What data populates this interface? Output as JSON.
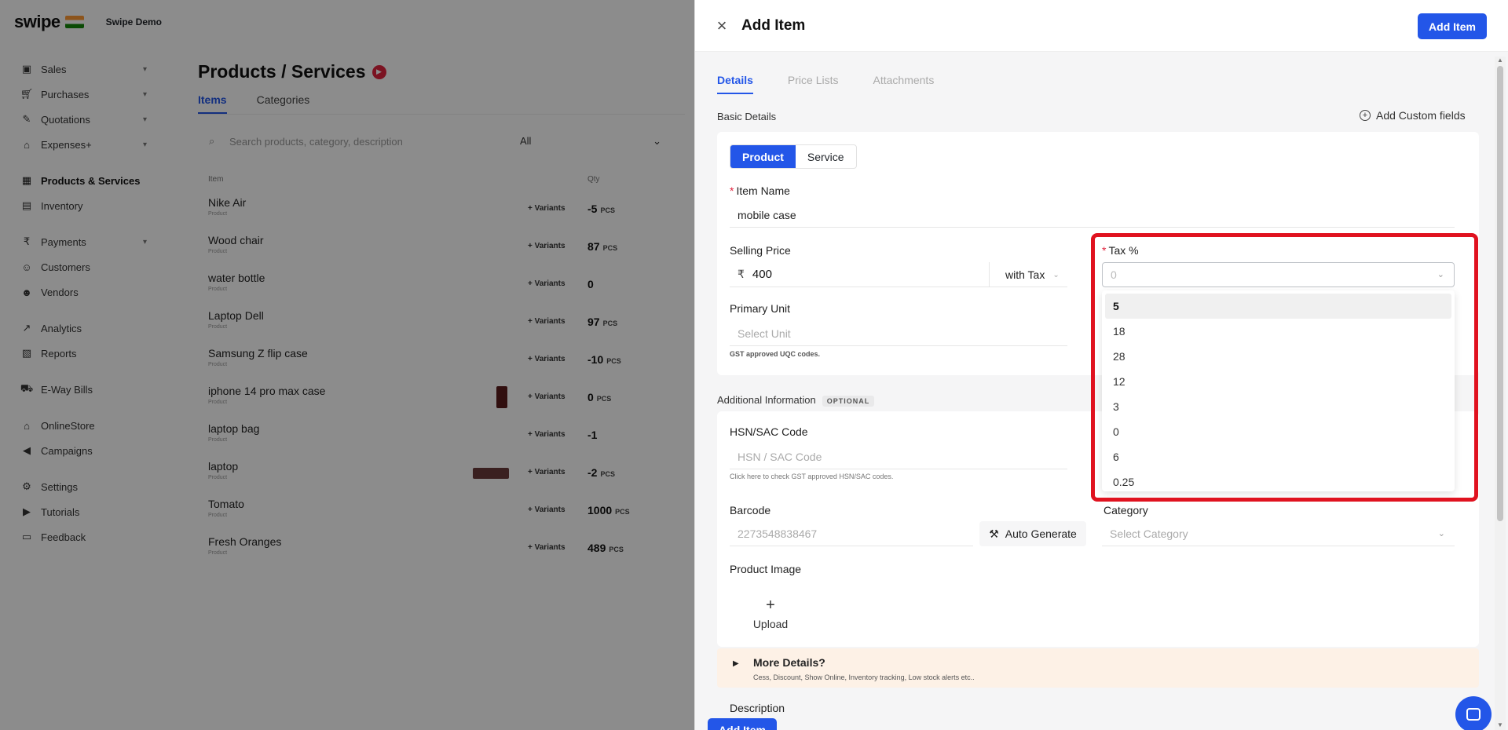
{
  "app": {
    "logo": "swipe",
    "company_name": "Swipe Demo"
  },
  "sidebar": {
    "items": [
      {
        "label": "Sales",
        "icon": "sales-icon"
      },
      {
        "label": "Purchases",
        "icon": "cart-icon"
      },
      {
        "label": "Quotations",
        "icon": "pen-icon"
      },
      {
        "label": "Expenses+",
        "icon": "tag-icon"
      },
      {
        "label": "Products & Services",
        "icon": "grid-icon"
      },
      {
        "label": "Inventory",
        "icon": "inventory-icon"
      },
      {
        "label": "Payments",
        "icon": "rupee-icon"
      },
      {
        "label": "Customers",
        "icon": "user-icon"
      },
      {
        "label": "Vendors",
        "icon": "users-icon"
      },
      {
        "label": "Analytics",
        "icon": "chart-icon"
      },
      {
        "label": "Reports",
        "icon": "report-icon"
      },
      {
        "label": "E-Way Bills",
        "icon": "truck-icon"
      },
      {
        "label": "OnlineStore",
        "icon": "store-icon"
      },
      {
        "label": "Campaigns",
        "icon": "megaphone-icon"
      },
      {
        "label": "Settings",
        "icon": "gear-icon"
      },
      {
        "label": "Tutorials",
        "icon": "youtube-icon"
      },
      {
        "label": "Feedback",
        "icon": "feedback-icon"
      }
    ]
  },
  "products_page": {
    "title": "Products / Services",
    "tabs": [
      "Items",
      "Categories"
    ],
    "search_placeholder": "Search products, category, description",
    "filter": "All",
    "columns": {
      "item": "Item",
      "qty": "Qty"
    },
    "variants_label": "+ Variants",
    "rows": [
      {
        "name": "Nike Air",
        "sub": "Product",
        "qty": "-5",
        "unit": "PCS"
      },
      {
        "name": "Wood chair",
        "sub": "Product",
        "qty": "87",
        "unit": "PCS"
      },
      {
        "name": "water bottle",
        "sub": "Product",
        "qty": "0",
        "unit": ""
      },
      {
        "name": "Laptop Dell",
        "sub": "Product",
        "qty": "97",
        "unit": "PCS"
      },
      {
        "name": "Samsung Z flip case",
        "sub": "Product",
        "qty": "-10",
        "unit": "PCS"
      },
      {
        "name": "iphone 14 pro max case",
        "sub": "Product",
        "qty": "0",
        "unit": "PCS"
      },
      {
        "name": "laptop bag",
        "sub": "Product",
        "qty": "-1",
        "unit": ""
      },
      {
        "name": "laptop",
        "sub": "Product",
        "qty": "-2",
        "unit": "PCS"
      },
      {
        "name": "Tomato",
        "sub": "Product",
        "qty": "1000",
        "unit": "PCS"
      },
      {
        "name": "Fresh Oranges",
        "sub": "Product",
        "qty": "489",
        "unit": "PCS"
      }
    ]
  },
  "drawer": {
    "title": "Add Item",
    "add_item_label": "Add Item",
    "tabs": [
      "Details",
      "Price Lists",
      "Attachments"
    ],
    "basic_details_label": "Basic Details",
    "add_custom_fields_label": "Add Custom fields",
    "type_options": [
      "Product",
      "Service"
    ],
    "item_name_label": "Item Name",
    "item_name_value": "mobile case",
    "selling_price_label": "Selling Price",
    "currency_symbol": "₹",
    "selling_price_value": "400",
    "tax_mode": "with Tax",
    "tax_label": "Tax %",
    "tax_current_value": "0",
    "tax_options": [
      "5",
      "18",
      "28",
      "12",
      "3",
      "0",
      "6",
      "0.25"
    ],
    "primary_unit_label": "Primary Unit",
    "primary_unit_placeholder": "Select Unit",
    "primary_unit_hint": "GST approved UQC codes.",
    "additional_info_label": "Additional Information",
    "optional_badge": "OPTIONAL",
    "hsn_label": "HSN/SAC Code",
    "hsn_placeholder": "HSN / SAC Code",
    "hsn_hint": "Click here to check GST approved HSN/SAC codes.",
    "barcode_label": "Barcode",
    "barcode_placeholder": "2273548838467",
    "auto_generate_label": "Auto Generate",
    "category_label": "Category",
    "category_placeholder": "Select Category",
    "product_image_label": "Product Image",
    "upload_label": "Upload",
    "more_details_title": "More Details?",
    "more_details_sub": "Cess, Discount, Show Online, Inventory tracking, Low stock alerts etc..",
    "description_label": "Description",
    "accent_color": "#2356e8",
    "highlight_color": "#e0121f"
  }
}
